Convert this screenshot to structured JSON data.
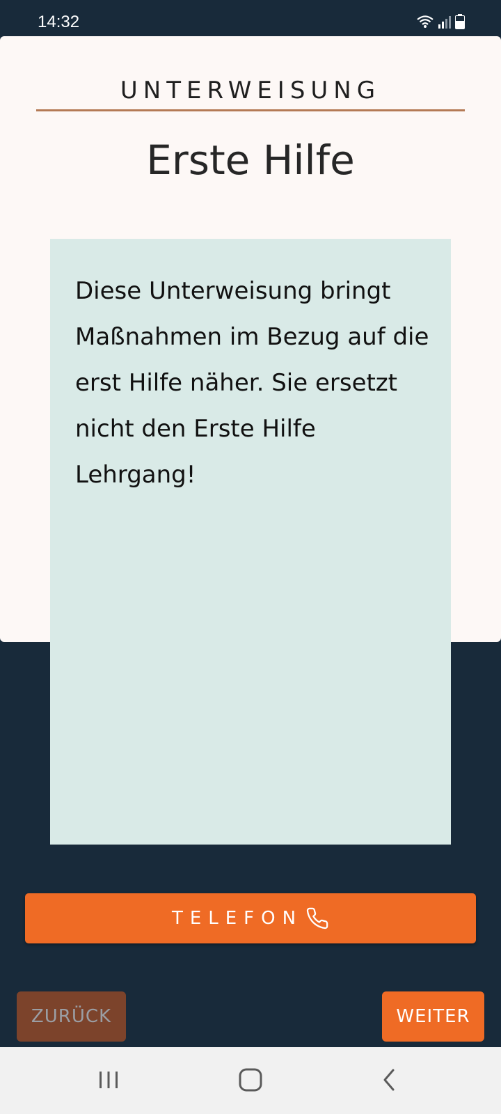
{
  "status_bar": {
    "time": "14:32",
    "icons": [
      "wifi-icon",
      "signal-icon",
      "battery-icon"
    ]
  },
  "header": {
    "eyebrow": "UNTERWEISUNG",
    "title": "Erste Hilfe"
  },
  "content": {
    "text": "Diese Unterweisung bringt Maßnahmen im Bezug auf die erst Hilfe näher. Sie ersetzt nicht den Erste Hilfe Lehrgang!"
  },
  "actions": {
    "telefon_label": "TELEFON",
    "telefon_icon": "phone-icon",
    "back_label": "ZURÜCK",
    "next_label": "WEITER"
  },
  "nav_bar": {
    "icons": [
      "recents-icon",
      "home-icon",
      "back-icon"
    ]
  },
  "colors": {
    "background": "#182a3a",
    "card": "#fdf8f6",
    "panel": "#d9eae7",
    "accent": "#ef6b25",
    "accent_muted": "#7c432b",
    "rule": "#b47a55"
  }
}
